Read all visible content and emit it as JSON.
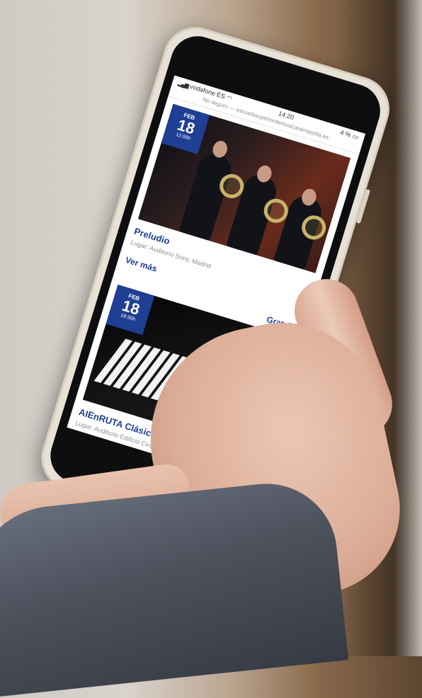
{
  "status_bar": {
    "carrier": "vodafone ES",
    "time": "14:20",
    "battery": "4 %"
  },
  "url_bar": {
    "security": "No seguro —",
    "url": "escuelasuperiordemusicareinasofia.es"
  },
  "events": [
    {
      "month": "FEB",
      "day": "18",
      "time": "12:00h",
      "title": "Preludio",
      "place": "Lugar: Auditorio Sony, Madrid",
      "more": "Ver más",
      "price": "Gratuito"
    },
    {
      "month": "FEB",
      "day": "18",
      "time": "19:30h",
      "title": "AIEnRUTA Clásicos: Nicolás Margarit",
      "place": "Lugar: Auditorio Edificio Circus"
    }
  ],
  "colors": {
    "accent": "#1f3f94",
    "muted_text": "#8a8f99"
  }
}
